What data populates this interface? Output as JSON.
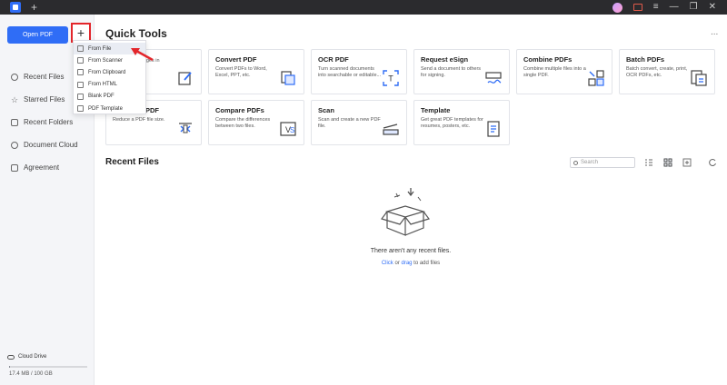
{
  "window": {
    "new_tab_label": "+"
  },
  "sidebar": {
    "open_pdf_label": "Open PDF",
    "plus_label": "+",
    "items": [
      {
        "label": "Recent Files",
        "icon": "clock-icon"
      },
      {
        "label": "Starred Files",
        "icon": "star-icon"
      },
      {
        "label": "Recent Folders",
        "icon": "folder-icon"
      },
      {
        "label": "Document Cloud",
        "icon": "cloud-icon"
      },
      {
        "label": "Agreement",
        "icon": "agreement-icon"
      }
    ],
    "cloud_drive_label": "Cloud Drive",
    "storage_text": "17.4 MB / 100 GB",
    "storage_fraction": 0.0002
  },
  "dropdown": {
    "items": [
      {
        "label": "From File",
        "icon": "file-icon",
        "active": true
      },
      {
        "label": "From Scanner",
        "icon": "scanner-icon"
      },
      {
        "label": "From Clipboard",
        "icon": "clipboard-icon"
      },
      {
        "label": "From HTML",
        "icon": "html-icon"
      },
      {
        "label": "Blank PDF",
        "icon": "blank-pdf-icon"
      },
      {
        "label": "PDF Template",
        "icon": "template-icon"
      }
    ]
  },
  "quick_tools": {
    "title": "Quick Tools",
    "more": "...",
    "cards": [
      {
        "title": "",
        "desc": "images in",
        "icon": "edit-icon"
      },
      {
        "title": "Convert PDF",
        "desc": "Convert PDFs to Word, Excel, PPT, etc.",
        "icon": "convert-icon"
      },
      {
        "title": "OCR PDF",
        "desc": "Turn scanned documents into searchable or editable...",
        "icon": "ocr-icon"
      },
      {
        "title": "Request eSign",
        "desc": "Send a document to others for signing.",
        "icon": "esign-icon"
      },
      {
        "title": "Combine PDFs",
        "desc": "Combine multiple files into a single PDF.",
        "icon": "combine-icon"
      },
      {
        "title": "Batch PDFs",
        "desc": "Batch convert, create, print, OCR PDFs, etc.",
        "icon": "batch-icon"
      },
      {
        "title": "PDF",
        "desc": "Reduce a PDF file size.",
        "icon": "compress-icon"
      },
      {
        "title": "Compare PDFs",
        "desc": "Compare the differences between two files.",
        "icon": "compare-icon"
      },
      {
        "title": "Scan",
        "desc": "Scan and create a new PDF file.",
        "icon": "scan-icon"
      },
      {
        "title": "Template",
        "desc": "Get great PDF templates for resumes, posters, etc.",
        "icon": "template-doc-icon"
      }
    ]
  },
  "recent": {
    "title": "Recent Files",
    "search_placeholder": "Search",
    "empty_text": "There aren't any recent files.",
    "empty_link_click": "Click",
    "empty_or": " or ",
    "empty_link_drag": "drag",
    "empty_suffix": " to add files"
  },
  "colors": {
    "accent": "#2f6df6",
    "highlight_red": "#e3262b"
  }
}
